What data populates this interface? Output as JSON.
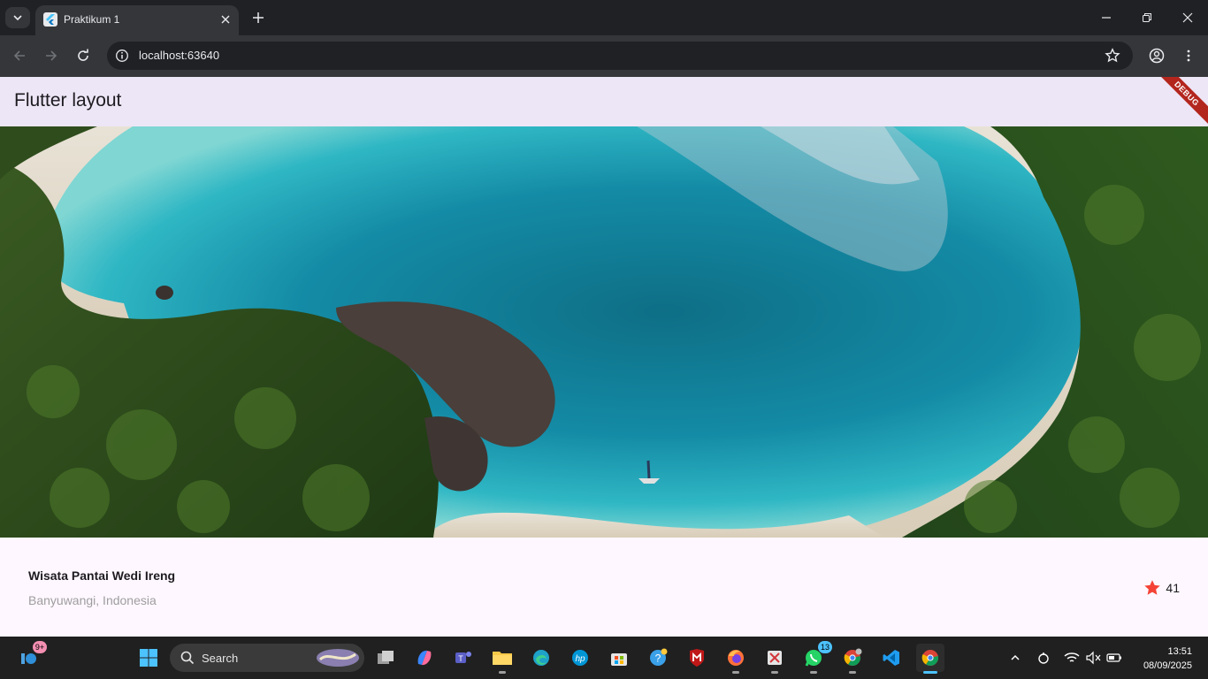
{
  "browser": {
    "tab": {
      "title": "Praktikum 1",
      "favicon": "flutter-icon"
    },
    "address": {
      "url": "localhost:63640"
    }
  },
  "app": {
    "appbar_title": "Flutter layout",
    "debug_banner": "DEBUG",
    "hero_image": "beach-bay-photo",
    "place": {
      "name": "Wisata Pantai Wedi Ireng",
      "location": "Banyuwangi, Indonesia"
    },
    "rating": {
      "count": "41",
      "icon": "star-icon",
      "color": "#f44336"
    }
  },
  "taskbar": {
    "search_label": "Search",
    "widgets_badge": "9+",
    "whatsapp_badge": "13",
    "clock": {
      "time": "13:51",
      "date": "08/09/2025"
    }
  }
}
